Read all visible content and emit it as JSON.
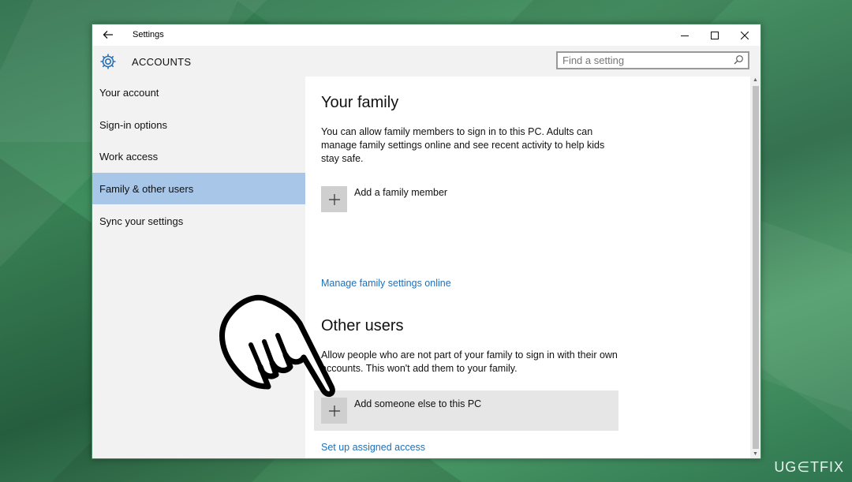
{
  "window": {
    "title": "Settings",
    "header_title": "ACCOUNTS"
  },
  "search": {
    "placeholder": "Find a setting"
  },
  "sidebar": {
    "items": [
      {
        "label": "Your account"
      },
      {
        "label": "Sign-in options"
      },
      {
        "label": "Work access"
      },
      {
        "label": "Family & other users"
      },
      {
        "label": "Sync your settings"
      }
    ],
    "active_index": 3
  },
  "family": {
    "heading": "Your family",
    "description": "You can allow family members to sign in to this PC. Adults can manage family settings online and see recent activity to help kids stay safe.",
    "add_label": "Add a family member",
    "manage_link": "Manage family settings online"
  },
  "other_users": {
    "heading": "Other users",
    "description": "Allow people who are not part of your family to sign in with their own accounts. This won't add them to your family.",
    "add_label": "Add someone else to this PC",
    "assigned_access_link": "Set up assigned access"
  },
  "watermark": "UG∈TFIX",
  "colors": {
    "accent": "#1f6fb8",
    "active_item": "#a7c6e8",
    "sidebar_bg": "#f2f2f2",
    "header_icon": "#2b6fb5"
  }
}
